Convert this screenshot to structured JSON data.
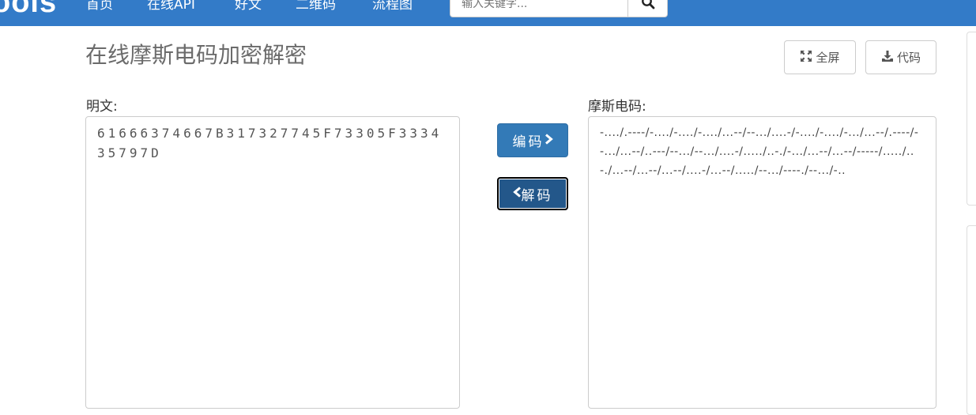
{
  "navbar": {
    "brand": "oois",
    "items": [
      "首页",
      "在线API",
      "好文",
      "二维码",
      "流程图"
    ],
    "search_placeholder": "输入关键字..."
  },
  "page": {
    "title": "在线摩斯电码加密解密",
    "fullscreen_label": "全屏",
    "code_label": "代码"
  },
  "plain": {
    "label": "明文:",
    "value": "61666374667B317327745F73305F333435797D"
  },
  "morse": {
    "label": "摩斯电码:",
    "value": "-..../.----/-..../-..../-..../...--/--.../....-/-..../-..../-.../...--/.----/--.../...--/..---/--.../--.../....-/...../..-./-.../...--/...--/-----/...../..-./...--/...--/...--/....-/...--/...../--.../----./--.../-.."
  },
  "actions": {
    "encode_label": "编码",
    "decode_label": "解码"
  },
  "icons": {
    "search": "search-icon",
    "fullscreen": "expand-icon",
    "download": "download-icon",
    "encode": "chevron-right-icon",
    "decode": "chevron-left-icon"
  },
  "colors": {
    "navbar": "#337bc8",
    "primary_button": "#337ab7",
    "active_button": "#23578a"
  }
}
